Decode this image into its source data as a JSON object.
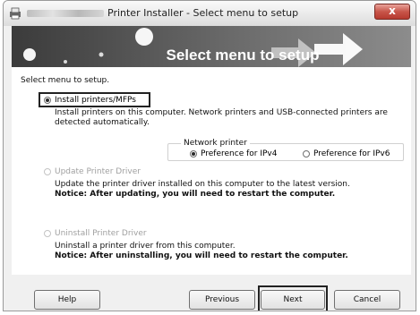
{
  "window": {
    "title": "Printer Installer - Select menu to setup",
    "close_label": "x"
  },
  "banner": {
    "title": "Select menu to setup"
  },
  "main": {
    "instruction": "Select menu to setup.",
    "options": [
      {
        "label": "Install printers/MFPs",
        "description": "Install printers on this computer. Network printers and USB-connected printers are detected automatically.",
        "selected": true,
        "enabled": true
      },
      {
        "label": "Update Printer Driver",
        "description": "Update the printer driver installed on this computer to the latest version.",
        "notice": "Notice: After updating, you will need to restart the computer.",
        "selected": false,
        "enabled": false
      },
      {
        "label": "Uninstall Printer Driver",
        "description": "Uninstall a printer driver from this computer.",
        "notice": "Notice: After uninstalling, you will need to restart the computer.",
        "selected": false,
        "enabled": false
      }
    ],
    "network_printer": {
      "legend": "Network printer",
      "options": [
        "Preference for IPv4",
        "Preference for IPv6"
      ],
      "selected": "Preference for IPv4"
    }
  },
  "footer": {
    "help_label": "Help",
    "previous_label": "Previous",
    "next_label": "Next",
    "cancel_label": "Cancel"
  }
}
